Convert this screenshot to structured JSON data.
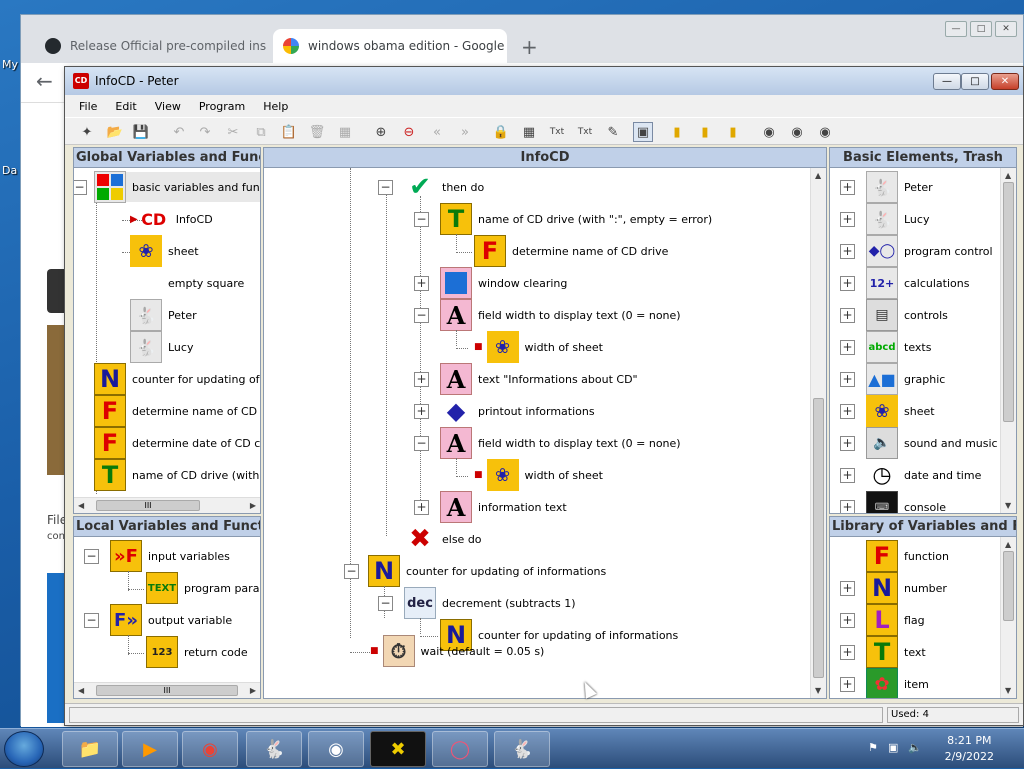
{
  "desktop": {
    "labels": [
      "My",
      "Da"
    ]
  },
  "browser": {
    "tabs": [
      {
        "label": "Release Official pre-compiled ins",
        "icon": "github-icon"
      },
      {
        "label": "windows obama edition - Google",
        "icon": "google-icon"
      }
    ],
    "new_tab": "+",
    "close": "✕",
    "page_fragments": [
      "File",
      "con"
    ]
  },
  "app": {
    "title": "InfoCD - Peter",
    "menu": [
      "File",
      "Edit",
      "View",
      "Program",
      "Help"
    ],
    "left_top": {
      "header": "Global Variables and Functio",
      "items": [
        {
          "label": "basic variables and functic",
          "icon": "basic-variables-icon"
        },
        {
          "label": "InfoCD",
          "icon": "infocd-icon"
        },
        {
          "label": "sheet",
          "icon": "sheet-icon"
        },
        {
          "label": "empty square",
          "icon": "empty-square-icon"
        },
        {
          "label": "Peter",
          "icon": "bunny-peter-icon"
        },
        {
          "label": "Lucy",
          "icon": "bunny-lucy-icon"
        },
        {
          "label": "counter for updating of info",
          "icon": "number-icon",
          "glyph": "N"
        },
        {
          "label": "determine name of CD driv",
          "icon": "function-icon",
          "glyph": "F"
        },
        {
          "label": "determine date of CD comp",
          "icon": "function-icon",
          "glyph": "F"
        },
        {
          "label": "name of CD drive (with \":\",",
          "icon": "text-icon",
          "glyph": "T"
        }
      ],
      "scroll_thumb": "III"
    },
    "left_bottom": {
      "header": "Local Variables and Function",
      "items": [
        {
          "label": "input variables",
          "icon": "input-variables-icon"
        },
        {
          "label": "program parame",
          "icon": "program-param-icon"
        },
        {
          "label": "output variable",
          "icon": "output-variable-icon"
        },
        {
          "label": "return code",
          "icon": "return-code-icon"
        }
      ],
      "scroll_thumb": "III"
    },
    "center": {
      "header": "InfoCD",
      "items": [
        {
          "label": "then do",
          "icon": "check-icon"
        },
        {
          "label": "name of CD drive (with \":\", empty = error)",
          "icon": "text-icon",
          "glyph": "T"
        },
        {
          "label": "determine name of CD drive",
          "icon": "function-icon",
          "glyph": "F"
        },
        {
          "label": "window clearing",
          "icon": "window-clear-icon"
        },
        {
          "label": "field width to display text (0 = none)",
          "icon": "field-width-icon",
          "glyph": "A"
        },
        {
          "label": "width of sheet",
          "icon": "sheet-width-icon"
        },
        {
          "label": "text \"Informations about CD\"",
          "icon": "text-a-icon",
          "glyph": "A"
        },
        {
          "label": "printout informations",
          "icon": "printout-icon",
          "glyph": "?"
        },
        {
          "label": "field width to display text (0 = none)",
          "icon": "field-width-icon",
          "glyph": "A"
        },
        {
          "label": "width of sheet",
          "icon": "sheet-width-icon"
        },
        {
          "label": "information text",
          "icon": "text-a-icon",
          "glyph": "A"
        },
        {
          "label": "else do",
          "icon": "cross-icon"
        },
        {
          "label": "counter for updating of informations",
          "icon": "number-icon",
          "glyph": "N"
        },
        {
          "label": "decrement (subtracts 1)",
          "icon": "dec-icon",
          "glyph": "dec"
        },
        {
          "label": "counter for updating of informations",
          "icon": "number-icon",
          "glyph": "N"
        },
        {
          "label": "wait (default = 0.05 s)",
          "icon": "stopwatch-icon"
        }
      ]
    },
    "right_top": {
      "header": "Basic Elements, Trash",
      "items": [
        {
          "label": "Peter",
          "icon": "bunny-peter-icon"
        },
        {
          "label": "Lucy",
          "icon": "bunny-lucy-icon"
        },
        {
          "label": "program control",
          "icon": "program-control-icon"
        },
        {
          "label": "calculations",
          "icon": "calculations-icon"
        },
        {
          "label": "controls",
          "icon": "controls-icon"
        },
        {
          "label": "texts",
          "icon": "texts-icon"
        },
        {
          "label": "graphic",
          "icon": "graphic-icon"
        },
        {
          "label": "sheet",
          "icon": "sheet-icon"
        },
        {
          "label": "sound and music",
          "icon": "sound-icon"
        },
        {
          "label": "date and time",
          "icon": "clock-icon"
        },
        {
          "label": "console",
          "icon": "console-icon"
        }
      ]
    },
    "right_bottom": {
      "header": "Library of Variables and Func",
      "items": [
        {
          "label": "function",
          "icon": "function-icon",
          "glyph": "F"
        },
        {
          "label": "number",
          "icon": "number-icon",
          "glyph": "N"
        },
        {
          "label": "flag",
          "icon": "flag-icon",
          "glyph": "L"
        },
        {
          "label": "text",
          "icon": "text-icon",
          "glyph": "T"
        },
        {
          "label": "item",
          "icon": "item-icon"
        }
      ]
    },
    "status": {
      "used": "Used: 4"
    }
  },
  "taskbar": {
    "clock_time": "8:21 PM",
    "clock_date": "2/9/2022"
  },
  "colors": {
    "accent": "#c0d0e8",
    "folder_yellow": "#f7c10b"
  }
}
